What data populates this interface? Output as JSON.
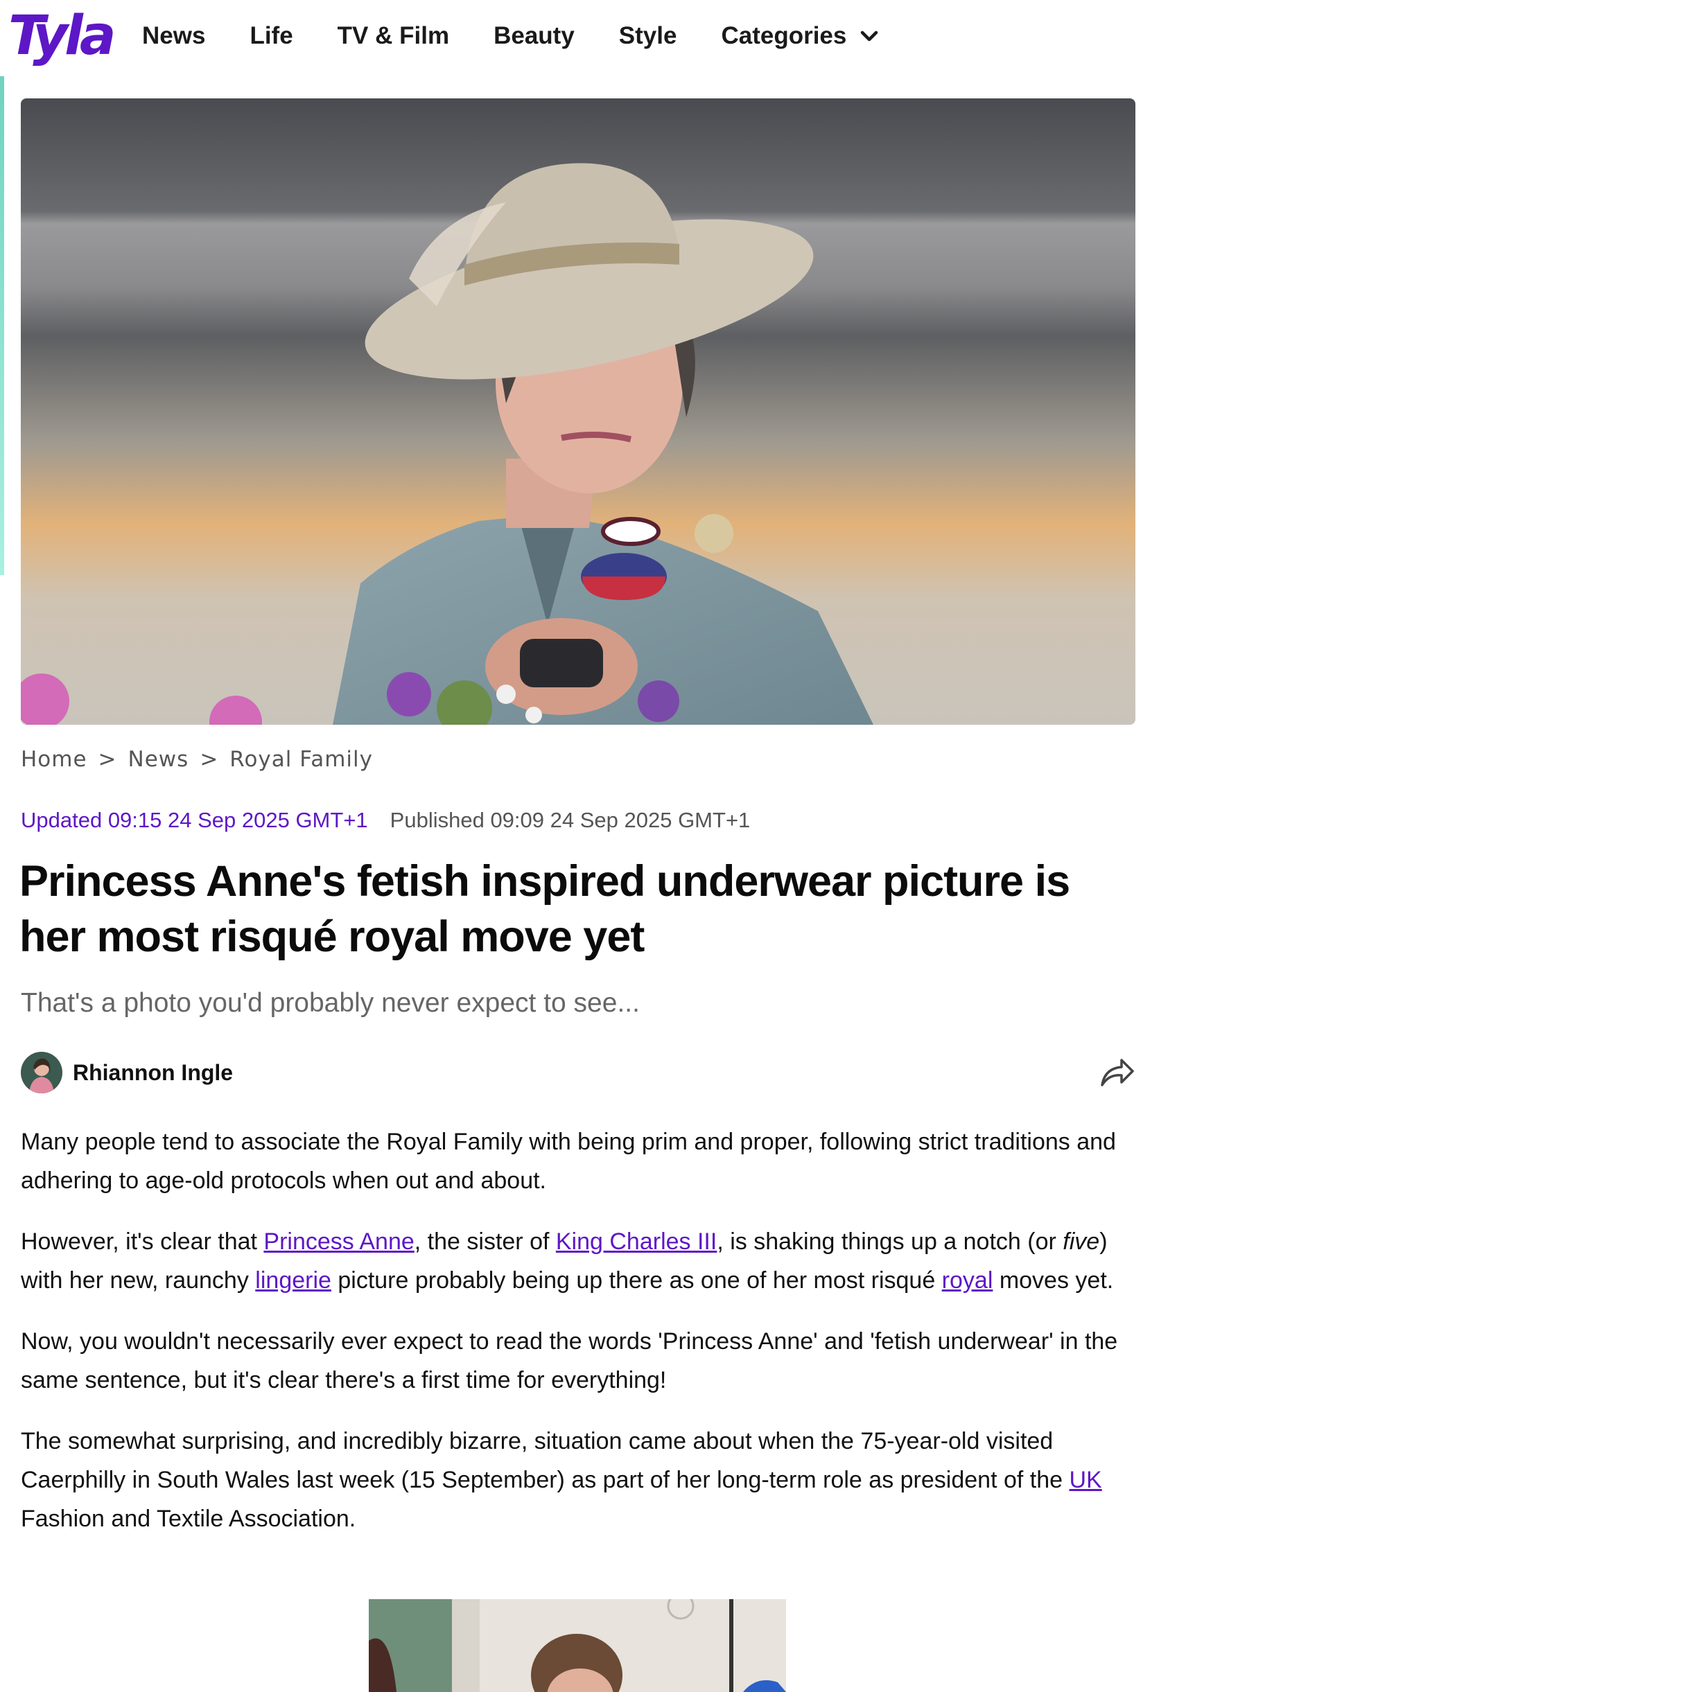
{
  "brand": {
    "logo_text": "Tyla",
    "accent_color": "#5d17c6"
  },
  "nav": {
    "items": [
      "News",
      "Life",
      "TV & Film",
      "Beauty",
      "Style"
    ],
    "categories_label": "Categories"
  },
  "breadcrumb": [
    "Home",
    "News",
    "Royal Family"
  ],
  "dates": {
    "updated": "Updated 09:15 24 Sep 2025 GMT+1",
    "published": "Published 09:09 24 Sep 2025 GMT+1"
  },
  "article": {
    "headline": "Princess Anne's fetish inspired underwear picture is her most risqué royal move yet",
    "standfirst": "That's a photo you'd probably never expect to see...",
    "author": "Rhiannon Ingle",
    "p1": "Many people tend to associate the Royal Family with being prim and proper, following strict traditions and adhering to age-old protocols when out and about.",
    "p2": {
      "t1": "However, it's clear that ",
      "link1": "Princess Anne",
      "t2": ", the sister of ",
      "link2": "King Charles III",
      "t3": ", is shaking things up a notch (or ",
      "em": "five",
      "t4": ") with her new, raunchy ",
      "link3": "lingerie",
      "t5": " picture probably being up there as one of her most risqué ",
      "link4": "royal",
      "t6": " moves yet."
    },
    "p3": "Now, you wouldn't necessarily ever expect to read the words 'Princess Anne' and 'fetish underwear' in the same sentence, but it's clear there's a first time for everything!",
    "p4": {
      "t1": "The somewhat surprising, and incredibly bizarre, situation came about when the 75-year-old visited Caerphilly in South Wales last week (15 September) as part of her long-term role as president of the ",
      "link1": "UK",
      "t2": " Fashion and Textile Association."
    }
  }
}
